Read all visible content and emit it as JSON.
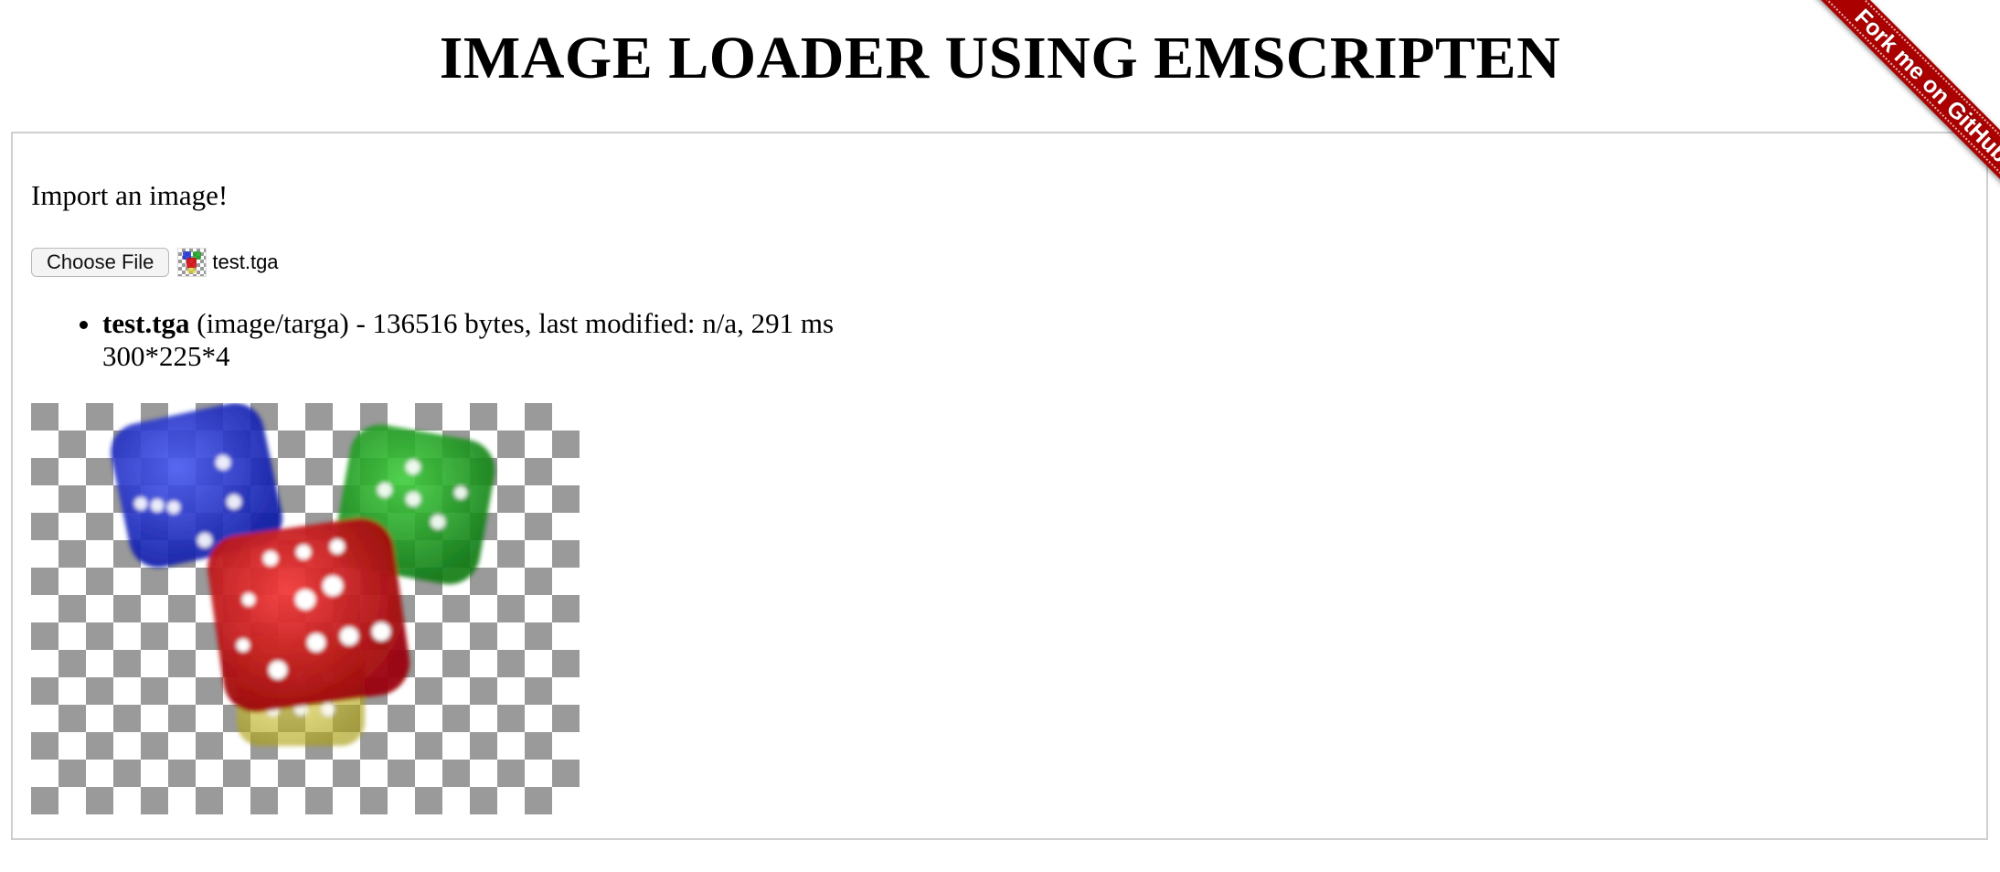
{
  "page": {
    "title": "IMAGE LOADER USING EMSCRIPTEN",
    "intro": "Import an image!"
  },
  "file_input": {
    "button_label": "Choose File",
    "thumbnail_icon": "dice-thumbnail-icon",
    "file_name": "test.tga"
  },
  "file_info": {
    "name": "test.tga",
    "details": " (image/targa) - 136516 bytes, last modified: n/a, 291 ms",
    "dimensions": "300*225*4"
  },
  "preview": {
    "checker_dark": "#9a9a9a",
    "checker_light": "#ffffff",
    "dice": [
      {
        "color": "blue",
        "hex": "#1a2fd6"
      },
      {
        "color": "green",
        "hex": "#18a021"
      },
      {
        "color": "red",
        "hex": "#d10d12"
      },
      {
        "color": "yellow",
        "hex": "#d6c92a"
      }
    ]
  },
  "ribbon": {
    "label": "Fork me on GitHub",
    "color": "#aa0000"
  }
}
